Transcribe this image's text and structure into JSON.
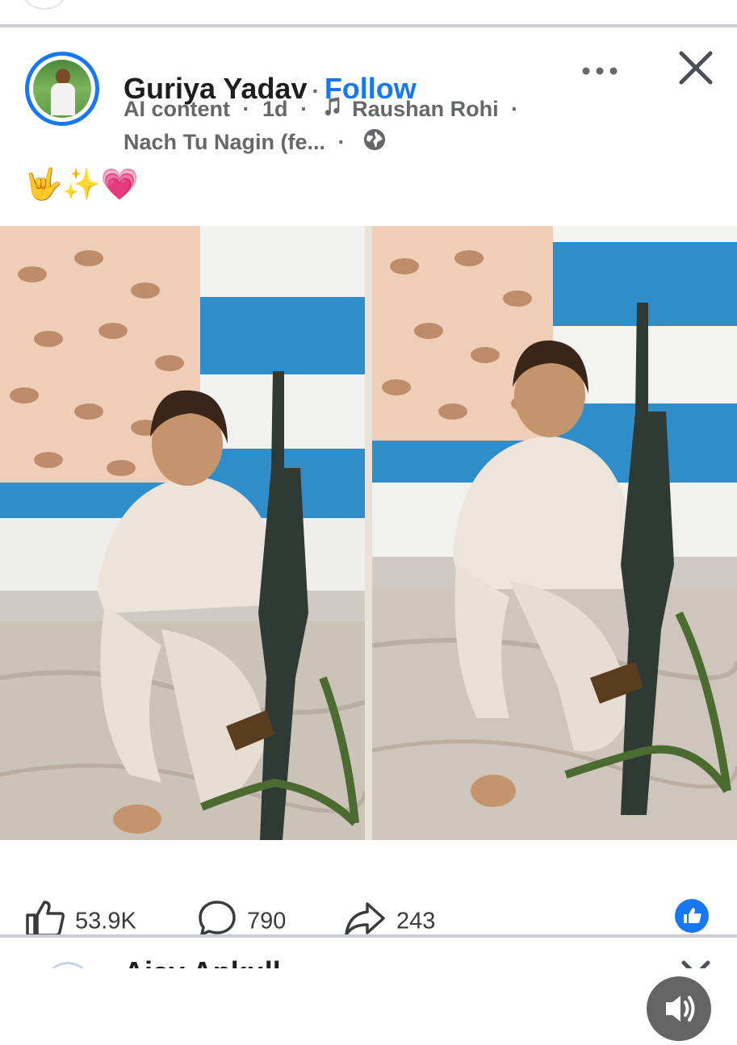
{
  "post": {
    "author": "Guriya Yadav",
    "separator": "·",
    "follow_label": "Follow",
    "ai_label": "AI content",
    "time": "1d",
    "music_artist": "Raushan Rohi",
    "song_title": "Nach Tu Nagin (fe...",
    "caption": "🤟✨💗",
    "stats": {
      "likes": "53.9K",
      "comments": "790",
      "shares": "243"
    }
  },
  "next_post": {
    "author_partial": "Ajay Ankull"
  },
  "colors": {
    "accent": "#1877f2",
    "muted_text": "#65676b",
    "divider": "#c9ccd1"
  },
  "icons": [
    "more-icon",
    "close-icon",
    "music-note-icon",
    "globe-icon",
    "sound-icon",
    "like-icon",
    "comment-icon",
    "share-icon",
    "like-badge-icon"
  ]
}
